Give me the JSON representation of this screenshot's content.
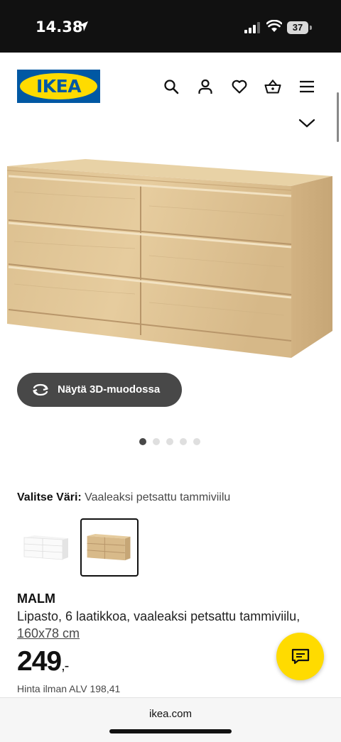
{
  "status_bar": {
    "time": "14.38",
    "battery": "37"
  },
  "brand": {
    "logo_text": "IKEA",
    "colors": {
      "blue": "#0058a3",
      "yellow": "#ffdb00"
    }
  },
  "header_icons": [
    "search-icon",
    "account-icon",
    "heart-icon",
    "basket-icon",
    "menu-icon",
    "chevron-down-icon"
  ],
  "viewer": {
    "button_3d_label": "Näytä 3D-muodossa",
    "image_count": 5,
    "active_image": 1
  },
  "color_picker": {
    "label": "Valitse Väri:",
    "selected": "Vaaleaksi petsattu tammiviilu",
    "options": [
      {
        "color": "#f4f4f4"
      },
      {
        "color": "#d8b888",
        "selected": true
      }
    ]
  },
  "product": {
    "name": "MALM",
    "description": "Lipasto, 6 laatikkoa, vaaleaksi petsattu tammiviilu,",
    "measurement": "160x78 cm",
    "price_integer": "249",
    "price_suffix": ",-",
    "vat_text": "Hinta ilman ALV 198,41"
  },
  "browser": {
    "url": "ikea.com"
  }
}
